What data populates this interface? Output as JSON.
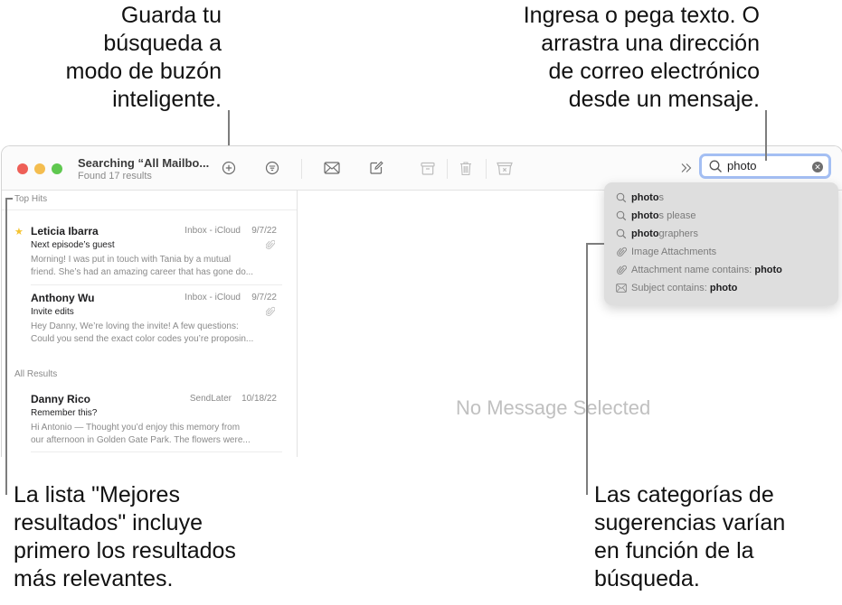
{
  "callouts": {
    "save_search": [
      "Guarda tu",
      "búsqueda a",
      "modo de buzón",
      "inteligente."
    ],
    "search_field": [
      "Ingresa o pega texto. O",
      "arrastra una dirección",
      "de correo electrónico",
      "desde un mensaje."
    ],
    "top_hits": [
      "La lista \"Mejores",
      "resultados\" incluye",
      "primero los resultados",
      "más relevantes."
    ],
    "suggestions": [
      "Las categorías de",
      "sugerencias varían",
      "en función de la",
      "búsqueda."
    ]
  },
  "window": {
    "title": "Searching “All Mailbo...",
    "subtitle": "Found 17 results",
    "traffic_lights": {
      "close": "#ee5f57",
      "minimize": "#f4bd4f",
      "zoom": "#5fc84f"
    },
    "toolbar": {
      "icons": [
        "add-smart-mailbox-icon",
        "filter-icon",
        "get-mail-icon",
        "compose-icon",
        "archive-icon",
        "trash-icon",
        "junk-icon",
        "more-chevron-icon"
      ]
    },
    "search": {
      "value": "photo",
      "accent": "#a4bff3"
    }
  },
  "message_list": {
    "sections": [
      {
        "label": "Top Hits",
        "messages": [
          {
            "from": "Leticia Ibarra",
            "mailbox": "Inbox - iCloud",
            "date": "9/7/22",
            "subject": "Next episode’s guest",
            "preview": [
              "Morning! I was put in touch with Tania by a mutual",
              "friend. She’s had an amazing career that has gone do..."
            ],
            "flagged": true,
            "attachment": true
          },
          {
            "from": "Anthony Wu",
            "mailbox": "Inbox - iCloud",
            "date": "9/7/22",
            "subject": "Invite edits",
            "preview": [
              "Hey Danny, We’re loving the invite! A few questions:",
              "Could you send the exact color codes you’re proposin..."
            ],
            "flagged": false,
            "attachment": true
          }
        ]
      },
      {
        "label": "All Results",
        "messages": [
          {
            "from": "Danny Rico",
            "mailbox": "SendLater",
            "date": "10/18/22",
            "subject": "Remember this?",
            "preview": [
              "Hi Antonio — Thought you’d enjoy this memory from",
              "our afternoon in Golden Gate Park. The flowers were..."
            ],
            "flagged": false,
            "attachment": false
          }
        ]
      }
    ]
  },
  "viewer": {
    "empty_text": "No Message Selected"
  },
  "suggestions": [
    {
      "icon": "search-icon",
      "bold": "photo",
      "rest": "s"
    },
    {
      "icon": "search-icon",
      "bold": "photo",
      "rest": "s please"
    },
    {
      "icon": "search-icon",
      "bold": "photo",
      "rest": "graphers"
    },
    {
      "icon": "paperclip-icon",
      "prefix": "Image Attachments"
    },
    {
      "icon": "paperclip-icon",
      "prefix": "Attachment name contains: ",
      "term": "photo"
    },
    {
      "icon": "envelope-icon",
      "prefix": "Subject contains: ",
      "term": "photo"
    }
  ]
}
